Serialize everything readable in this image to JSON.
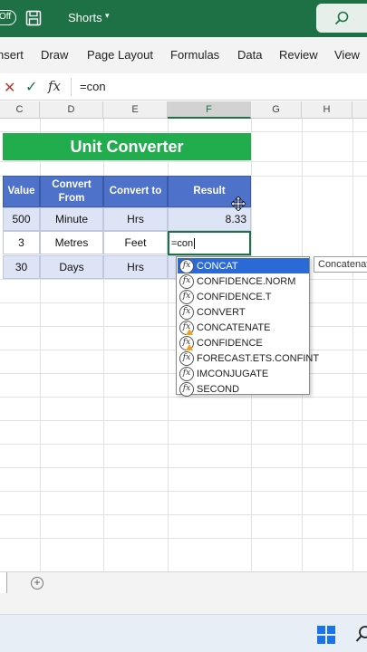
{
  "titlebar": {
    "toggle_label": "Off",
    "doc_title": "Shorts",
    "caret": "▾"
  },
  "ribbon": {
    "tabs": [
      "nsert",
      "Draw",
      "Page Layout",
      "Formulas",
      "Data",
      "Review",
      "View"
    ]
  },
  "formula_bar": {
    "cancel": "✕",
    "enter": "✓",
    "fx": "fx",
    "content": "=con"
  },
  "columns": [
    "C",
    "D",
    "E",
    "F",
    "G",
    "H"
  ],
  "sheet": {
    "title": "Unit Converter",
    "headers": [
      "Value",
      "Convert From",
      "Convert to",
      "Result"
    ],
    "rows": [
      [
        "500",
        "Minute",
        "Hrs",
        "8.33"
      ],
      [
        "3",
        "Metres",
        "Feet",
        "=con"
      ],
      [
        "30",
        "Days",
        "Hrs",
        ""
      ]
    ]
  },
  "autocomplete": {
    "items": [
      "CONCAT",
      "CONFIDENCE.NORM",
      "CONFIDENCE.T",
      "CONVERT",
      "CONCATENATE",
      "CONFIDENCE",
      "FORECAST.ETS.CONFINT",
      "IMCONJUGATE",
      "SECOND"
    ],
    "warn_items": [
      4,
      5
    ],
    "selected": 0,
    "icon_glyph": "fx",
    "tooltip": "Concatenates"
  },
  "sheetbar": {
    "add_label": "+"
  },
  "colors": {
    "excel_green": "#1e7145",
    "banner_green": "#21ac4d",
    "header_blue": "#4e71c9",
    "cell_blue": "#dde4f5",
    "selection_blue": "#2b6ad6"
  }
}
